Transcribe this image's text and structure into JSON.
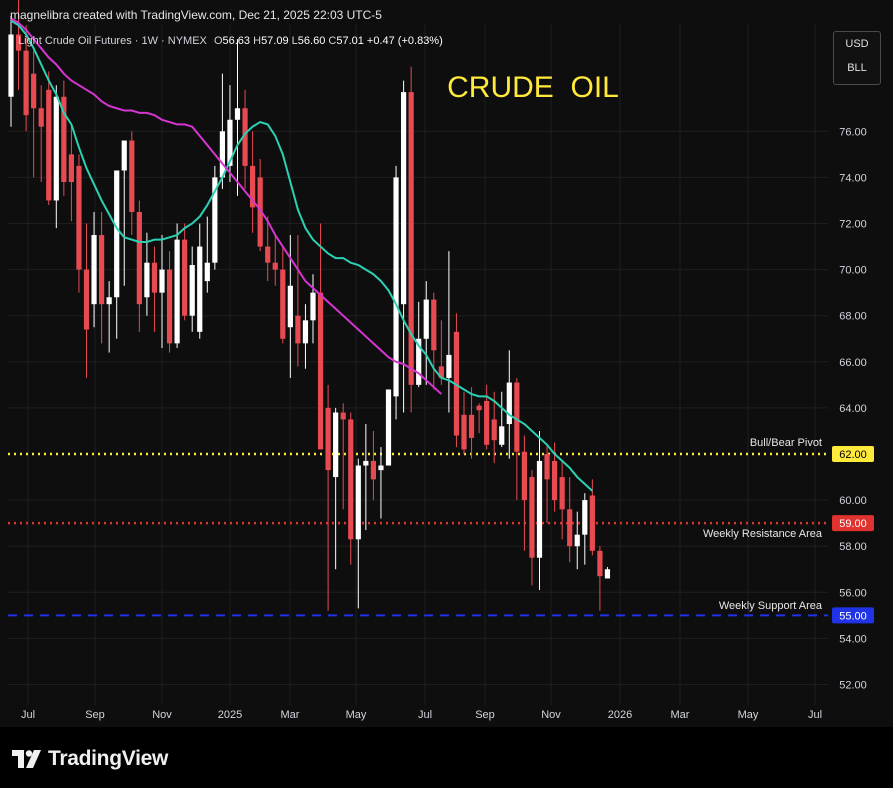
{
  "header": {
    "credit": "magnelibra created with TradingView.com, Dec 21, 2025 22:03 UTC-5"
  },
  "legend": {
    "symbol": "Light Crude Oil Futures · 1W · NYMEX",
    "o_label": "O",
    "o_value": "56.63",
    "h_label": "H",
    "h_value": "57.09",
    "l_label": "L",
    "l_value": "56.60",
    "c_label": "C",
    "c_value": "57.01",
    "change": "+0.47 (+0.83%)"
  },
  "units": {
    "currency": "USD",
    "unit": "BLL"
  },
  "footer": {
    "brand": "TradingView"
  },
  "colors": {
    "background": "#0e0e0e",
    "up": "#ffffff",
    "down": "#e84a52",
    "ema_fast": "#2bd1b3",
    "ema_slow": "#d535d1",
    "pivot": "#ffe93b",
    "resistance": "#e0322e",
    "support": "#2033e6",
    "title": "#ffe93b"
  },
  "chart_data": {
    "type": "candlestick",
    "title": "CRUDE  OIL",
    "ylim": [
      51,
      80
    ],
    "y_ticks": [
      "52.00",
      "54.00",
      "56.00",
      "58.00",
      "60.00",
      "64.00",
      "66.00",
      "68.00",
      "70.00",
      "72.00",
      "74.00",
      "76.00"
    ],
    "x_ticks": [
      "Jul",
      "Sep",
      "Nov",
      "2025",
      "Mar",
      "May",
      "Jul",
      "Sep",
      "Nov",
      "2026",
      "Mar",
      "May",
      "Jul"
    ],
    "levels": [
      {
        "name": "Bull/Bear Pivot",
        "value": 62.0,
        "label": "62.00",
        "style": "dotted",
        "color": "#ffe93b"
      },
      {
        "name": "Weekly Resistance Area",
        "value": 59.0,
        "label": "59.00",
        "style": "dotted",
        "color": "#e0322e"
      },
      {
        "name": "Weekly Support Area",
        "value": 55.0,
        "label": "55.00",
        "style": "dashed",
        "color": "#2033e6"
      }
    ],
    "candles": [
      {
        "o": 77.5,
        "h": 81.0,
        "l": 76.2,
        "c": 80.2
      },
      {
        "o": 80.2,
        "h": 82.0,
        "l": 77.8,
        "c": 79.5
      },
      {
        "o": 79.5,
        "h": 80.6,
        "l": 76.0,
        "c": 76.7
      },
      {
        "o": 78.5,
        "h": 79.5,
        "l": 74.0,
        "c": 77.0
      },
      {
        "o": 77.0,
        "h": 78.0,
        "l": 73.8,
        "c": 76.2
      },
      {
        "o": 77.8,
        "h": 78.6,
        "l": 72.8,
        "c": 73.0
      },
      {
        "o": 73.0,
        "h": 78.0,
        "l": 71.8,
        "c": 77.5
      },
      {
        "o": 77.5,
        "h": 78.2,
        "l": 73.2,
        "c": 73.8
      },
      {
        "o": 75.0,
        "h": 76.2,
        "l": 72.1,
        "c": 73.8
      },
      {
        "o": 74.5,
        "h": 75.0,
        "l": 69.0,
        "c": 70.0
      },
      {
        "o": 70.0,
        "h": 72.0,
        "l": 65.3,
        "c": 67.4
      },
      {
        "o": 68.5,
        "h": 72.5,
        "l": 67.5,
        "c": 71.5
      },
      {
        "o": 71.5,
        "h": 72.5,
        "l": 66.8,
        "c": 68.5
      },
      {
        "o": 68.5,
        "h": 69.5,
        "l": 66.4,
        "c": 68.8
      },
      {
        "o": 68.8,
        "h": 72.0,
        "l": 67.0,
        "c": 74.3
      },
      {
        "o": 74.3,
        "h": 75.5,
        "l": 69.3,
        "c": 75.6
      },
      {
        "o": 75.6,
        "h": 76.0,
        "l": 71.5,
        "c": 72.5
      },
      {
        "o": 72.5,
        "h": 73.0,
        "l": 67.3,
        "c": 68.5
      },
      {
        "o": 68.8,
        "h": 71.6,
        "l": 68.0,
        "c": 70.3
      },
      {
        "o": 70.3,
        "h": 71.0,
        "l": 67.3,
        "c": 69.0
      },
      {
        "o": 69.0,
        "h": 71.5,
        "l": 66.6,
        "c": 70.0
      },
      {
        "o": 70.0,
        "h": 70.8,
        "l": 66.4,
        "c": 66.8
      },
      {
        "o": 66.8,
        "h": 72.0,
        "l": 66.6,
        "c": 71.3
      },
      {
        "o": 71.3,
        "h": 72.0,
        "l": 67.8,
        "c": 68.0
      },
      {
        "o": 68.0,
        "h": 71.0,
        "l": 67.3,
        "c": 70.2
      },
      {
        "o": 67.3,
        "h": 72.0,
        "l": 67.0,
        "c": 71.0
      },
      {
        "o": 69.5,
        "h": 72.3,
        "l": 69.0,
        "c": 70.3
      },
      {
        "o": 70.3,
        "h": 74.5,
        "l": 70.0,
        "c": 74.0
      },
      {
        "o": 74.0,
        "h": 78.5,
        "l": 73.5,
        "c": 76.0
      },
      {
        "o": 74.5,
        "h": 78.0,
        "l": 73.8,
        "c": 76.5
      },
      {
        "o": 76.5,
        "h": 80.0,
        "l": 73.2,
        "c": 77.0
      },
      {
        "o": 77.0,
        "h": 77.8,
        "l": 73.5,
        "c": 74.5
      },
      {
        "o": 74.5,
        "h": 76.0,
        "l": 71.6,
        "c": 72.7
      },
      {
        "o": 74.0,
        "h": 74.8,
        "l": 70.8,
        "c": 71.0
      },
      {
        "o": 71.0,
        "h": 72.3,
        "l": 69.5,
        "c": 70.3
      },
      {
        "o": 70.3,
        "h": 71.5,
        "l": 69.3,
        "c": 70.0
      },
      {
        "o": 70.0,
        "h": 71.0,
        "l": 66.8,
        "c": 67.0
      },
      {
        "o": 67.5,
        "h": 71.5,
        "l": 65.3,
        "c": 69.3
      },
      {
        "o": 68.0,
        "h": 71.5,
        "l": 65.8,
        "c": 66.8
      },
      {
        "o": 66.8,
        "h": 68.5,
        "l": 65.7,
        "c": 67.8
      },
      {
        "o": 67.8,
        "h": 69.8,
        "l": 66.8,
        "c": 69.0
      },
      {
        "o": 69.0,
        "h": 72.0,
        "l": 64.8,
        "c": 62.2
      },
      {
        "o": 64.0,
        "h": 65.0,
        "l": 55.2,
        "c": 61.3
      },
      {
        "o": 61.0,
        "h": 64.0,
        "l": 57.0,
        "c": 63.8
      },
      {
        "o": 63.8,
        "h": 64.2,
        "l": 59.6,
        "c": 63.5
      },
      {
        "o": 63.5,
        "h": 63.8,
        "l": 57.2,
        "c": 58.3
      },
      {
        "o": 58.3,
        "h": 61.8,
        "l": 55.3,
        "c": 61.5
      },
      {
        "o": 61.5,
        "h": 63.3,
        "l": 58.7,
        "c": 61.7
      },
      {
        "o": 61.7,
        "h": 63.0,
        "l": 60.0,
        "c": 60.9
      },
      {
        "o": 61.3,
        "h": 62.3,
        "l": 59.2,
        "c": 61.5
      },
      {
        "o": 61.5,
        "h": 64.6,
        "l": 62.4,
        "c": 64.8
      },
      {
        "o": 64.5,
        "h": 74.5,
        "l": 63.5,
        "c": 74.0
      },
      {
        "o": 68.5,
        "h": 78.2,
        "l": 63.8,
        "c": 77.7
      },
      {
        "o": 77.7,
        "h": 78.8,
        "l": 63.8,
        "c": 65.0
      },
      {
        "o": 65.0,
        "h": 68.6,
        "l": 64.9,
        "c": 67.0
      },
      {
        "o": 67.0,
        "h": 69.5,
        "l": 65.0,
        "c": 68.7
      },
      {
        "o": 68.7,
        "h": 69.0,
        "l": 64.8,
        "c": 66.5
      },
      {
        "o": 65.8,
        "h": 67.8,
        "l": 65.0,
        "c": 65.3
      },
      {
        "o": 65.3,
        "h": 70.8,
        "l": 63.8,
        "c": 66.3
      },
      {
        "o": 67.3,
        "h": 68.1,
        "l": 62.3,
        "c": 62.8
      },
      {
        "o": 63.7,
        "h": 64.7,
        "l": 62.0,
        "c": 62.2
      },
      {
        "o": 63.7,
        "h": 64.9,
        "l": 61.8,
        "c": 62.7
      },
      {
        "o": 64.1,
        "h": 64.2,
        "l": 62.9,
        "c": 63.9
      },
      {
        "o": 64.3,
        "h": 65.0,
        "l": 62.2,
        "c": 62.4
      },
      {
        "o": 63.5,
        "h": 64.7,
        "l": 61.6,
        "c": 62.6
      },
      {
        "o": 62.4,
        "h": 64.7,
        "l": 62.3,
        "c": 63.2
      },
      {
        "o": 63.3,
        "h": 66.5,
        "l": 61.8,
        "c": 65.1
      },
      {
        "o": 65.1,
        "h": 65.3,
        "l": 60.0,
        "c": 62.1
      },
      {
        "o": 62.1,
        "h": 62.8,
        "l": 57.8,
        "c": 60.0
      },
      {
        "o": 61.0,
        "h": 61.3,
        "l": 56.3,
        "c": 57.5
      },
      {
        "o": 57.5,
        "h": 63.0,
        "l": 56.1,
        "c": 61.7
      },
      {
        "o": 62.0,
        "h": 62.4,
        "l": 59.0,
        "c": 60.9
      },
      {
        "o": 61.7,
        "h": 62.5,
        "l": 59.5,
        "c": 60.0
      },
      {
        "o": 61.0,
        "h": 61.7,
        "l": 58.3,
        "c": 59.6
      },
      {
        "o": 59.6,
        "h": 61.0,
        "l": 57.3,
        "c": 58.0
      },
      {
        "o": 58.0,
        "h": 59.5,
        "l": 57.0,
        "c": 58.5
      },
      {
        "o": 58.5,
        "h": 60.3,
        "l": 57.2,
        "c": 60.0
      },
      {
        "o": 60.2,
        "h": 60.9,
        "l": 57.6,
        "c": 57.8
      },
      {
        "o": 57.8,
        "h": 58.0,
        "l": 55.2,
        "c": 56.7
      },
      {
        "o": 56.6,
        "h": 57.1,
        "l": 56.6,
        "c": 57.0
      }
    ],
    "ema_fast": [
      80.8,
      80.6,
      80.2,
      79.6,
      78.9,
      78.2,
      77.6,
      76.8,
      76.3,
      75.3,
      74.4,
      73.7,
      73.0,
      72.4,
      71.8,
      71.4,
      71.3,
      71.2,
      71.2,
      71.3,
      71.3,
      71.4,
      71.5,
      71.8,
      72.0,
      72.3,
      72.8,
      73.4,
      74.0,
      74.7,
      75.4,
      75.9,
      76.2,
      76.4,
      76.3,
      75.8,
      75.0,
      73.8,
      72.6,
      71.8,
      71.3,
      71.0,
      70.7,
      70.5,
      70.5,
      70.3,
      70.2,
      70.0,
      69.8,
      69.5,
      69.1,
      68.5,
      67.8,
      67.2,
      66.7,
      66.3,
      65.7,
      65.3,
      65.2,
      65.0,
      64.8,
      64.6,
      64.5,
      64.5,
      64.3,
      64.0,
      63.7,
      63.5,
      63.3,
      63.0,
      62.7,
      62.4,
      62.0,
      61.7,
      61.4,
      61.0,
      60.7,
      60.4
    ],
    "ema_slow": [
      80.9,
      80.7,
      80.4,
      80.0,
      79.6,
      79.2,
      78.9,
      78.5,
      78.2,
      78.0,
      77.8,
      77.6,
      77.3,
      77.1,
      77.0,
      76.9,
      76.9,
      76.8,
      76.8,
      76.7,
      76.5,
      76.4,
      76.3,
      76.3,
      76.2,
      75.8,
      75.4,
      75.0,
      74.6,
      74.2,
      73.8,
      73.4,
      73.0,
      72.6,
      72.1,
      71.5,
      71.0,
      70.5,
      70.0,
      69.5,
      69.2,
      68.9,
      68.6,
      68.3,
      68.0,
      67.7,
      67.4,
      67.1,
      66.8,
      66.5,
      66.2,
      66.0,
      65.9,
      65.7,
      65.5,
      65.2,
      64.9,
      64.6
    ]
  }
}
